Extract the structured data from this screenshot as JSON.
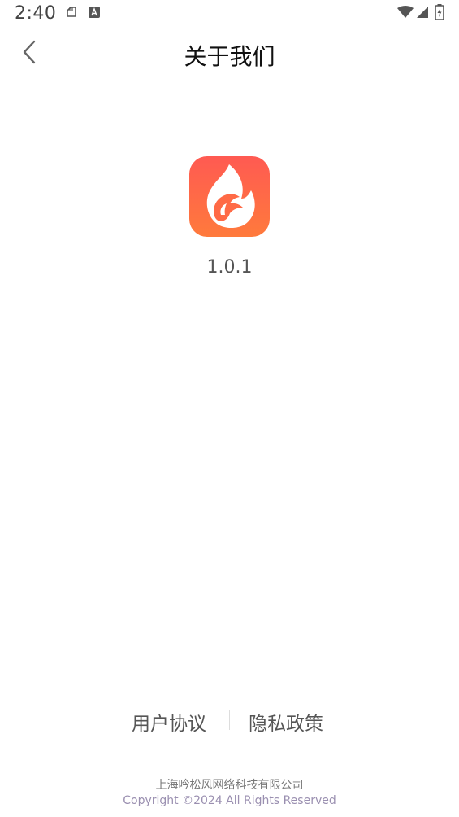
{
  "status_bar": {
    "time": "2:40",
    "icons": [
      "notification-icon",
      "font-icon",
      "wifi-icon",
      "signal-icon",
      "battery-charging-icon"
    ]
  },
  "nav": {
    "title": "关于我们",
    "back_icon": "chevron-left-icon"
  },
  "app": {
    "logo_icon": "flame-rabbit-logo",
    "version": "1.0.1",
    "brand_color_top": "#ff5a52",
    "brand_color_bottom": "#ff7a3c"
  },
  "links": {
    "user_agreement": "用户协议",
    "privacy_policy": "隐私政策"
  },
  "footer": {
    "company": "上海吟松风网络科技有限公司",
    "copyright": "Copyright ©2024 All Rights Reserved"
  }
}
